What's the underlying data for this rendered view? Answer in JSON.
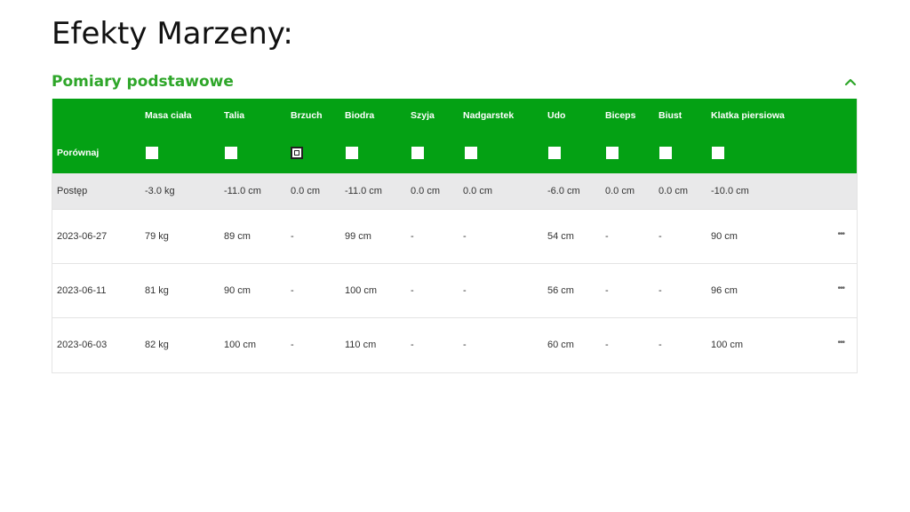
{
  "page": {
    "title": "Efekty Marzeny:"
  },
  "section": {
    "title": "Pomiary podstawowe"
  },
  "table": {
    "columns": [
      "Masa ciała",
      "Talia",
      "Brzuch",
      "Biodra",
      "Szyja",
      "Nadgarstek",
      "Udo",
      "Biceps",
      "Biust",
      "Klatka piersiowa"
    ],
    "compare_label": "Porównaj",
    "checked": [
      false,
      false,
      true,
      false,
      false,
      false,
      false,
      false,
      false,
      false
    ],
    "progress": {
      "label": "Postęp",
      "values": [
        "-3.0 kg",
        "-11.0 cm",
        "0.0 cm",
        "-11.0 cm",
        "0.0 cm",
        "0.0 cm",
        "-6.0 cm",
        "0.0 cm",
        "0.0 cm",
        "-10.0 cm"
      ]
    },
    "rows": [
      {
        "date": "2023-06-27",
        "values": [
          "79 kg",
          "89 cm",
          "-",
          "99 cm",
          "-",
          "-",
          "54 cm",
          "-",
          "-",
          "90 cm"
        ],
        "more": "•••"
      },
      {
        "date": "2023-06-11",
        "values": [
          "81 kg",
          "90 cm",
          "-",
          "100 cm",
          "-",
          "-",
          "56 cm",
          "-",
          "-",
          "96 cm"
        ],
        "more": "•••"
      },
      {
        "date": "2023-06-03",
        "values": [
          "82 kg",
          "100 cm",
          "-",
          "110 cm",
          "-",
          "-",
          "60 cm",
          "-",
          "-",
          "100 cm"
        ],
        "more": "•••"
      }
    ]
  },
  "colors": {
    "accent": "#04a114",
    "title_green": "#2ea629",
    "progress_bg": "#e9e9ea"
  },
  "icons": {
    "collapse": "chevron-up-icon",
    "more": "more-horizontal-icon"
  }
}
